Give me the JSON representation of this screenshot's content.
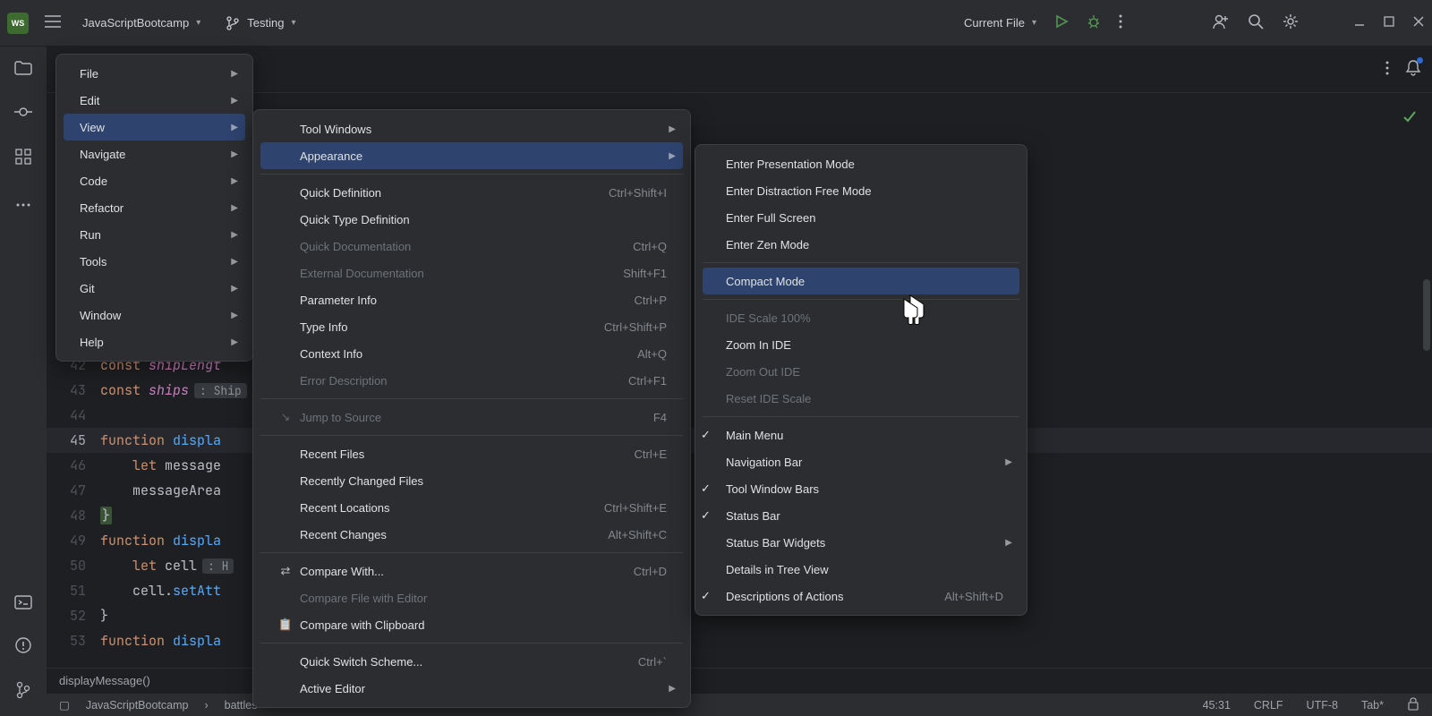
{
  "titlebar": {
    "project": "JavaScriptBootcamp",
    "branch": "Testing",
    "run_config": "Current File"
  },
  "code": {
    "lines": [
      {
        "n": "42",
        "html": "const shipLengt"
      },
      {
        "n": "43",
        "html": "const ships"
      },
      {
        "n": "44",
        "html": ""
      },
      {
        "n": "45",
        "html": "function displa"
      },
      {
        "n": "46",
        "html": "    let message"
      },
      {
        "n": "47",
        "html": "    messageArea"
      },
      {
        "n": "48",
        "html": "}"
      },
      {
        "n": "49",
        "html": "function displa"
      },
      {
        "n": "50",
        "html": "    let cell"
      },
      {
        "n": "51",
        "html": "    cell.setAtt"
      },
      {
        "n": "52",
        "html": "}"
      },
      {
        "n": "53",
        "html": "function displa"
      }
    ],
    "ann43": ": Ship",
    "ann50": ": H"
  },
  "menu1": {
    "items": [
      {
        "label": "File",
        "arrow": true
      },
      {
        "label": "Edit",
        "arrow": true
      },
      {
        "label": "View",
        "arrow": true,
        "selected": true
      },
      {
        "label": "Navigate",
        "arrow": true
      },
      {
        "label": "Code",
        "arrow": true
      },
      {
        "label": "Refactor",
        "arrow": true
      },
      {
        "label": "Run",
        "arrow": true
      },
      {
        "label": "Tools",
        "arrow": true
      },
      {
        "label": "Git",
        "arrow": true
      },
      {
        "label": "Window",
        "arrow": true
      },
      {
        "label": "Help",
        "arrow": true
      }
    ]
  },
  "menu2": {
    "groups": [
      [
        {
          "label": "Tool Windows",
          "arrow": true
        },
        {
          "label": "Appearance",
          "arrow": true,
          "selected": true
        }
      ],
      [
        {
          "label": "Quick Definition",
          "shortcut": "Ctrl+Shift+I"
        },
        {
          "label": "Quick Type Definition"
        },
        {
          "label": "Quick Documentation",
          "shortcut": "Ctrl+Q",
          "disabled": true
        },
        {
          "label": "External Documentation",
          "shortcut": "Shift+F1",
          "disabled": true
        },
        {
          "label": "Parameter Info",
          "shortcut": "Ctrl+P"
        },
        {
          "label": "Type Info",
          "shortcut": "Ctrl+Shift+P"
        },
        {
          "label": "Context Info",
          "shortcut": "Alt+Q"
        },
        {
          "label": "Error Description",
          "shortcut": "Ctrl+F1",
          "disabled": true
        }
      ],
      [
        {
          "label": "Jump to Source",
          "shortcut": "F4",
          "disabled": true,
          "icon": "↘"
        }
      ],
      [
        {
          "label": "Recent Files",
          "shortcut": "Ctrl+E"
        },
        {
          "label": "Recently Changed Files"
        },
        {
          "label": "Recent Locations",
          "shortcut": "Ctrl+Shift+E"
        },
        {
          "label": "Recent Changes",
          "shortcut": "Alt+Shift+C"
        }
      ],
      [
        {
          "label": "Compare With...",
          "shortcut": "Ctrl+D",
          "icon": "⇄"
        },
        {
          "label": "Compare File with Editor",
          "disabled": true
        },
        {
          "label": "Compare with Clipboard",
          "icon": "📋"
        }
      ],
      [
        {
          "label": "Quick Switch Scheme...",
          "shortcut": "Ctrl+`"
        },
        {
          "label": "Active Editor",
          "arrow": true
        }
      ]
    ]
  },
  "menu3": {
    "groups": [
      [
        {
          "label": "Enter Presentation Mode"
        },
        {
          "label": "Enter Distraction Free Mode"
        },
        {
          "label": "Enter Full Screen"
        },
        {
          "label": "Enter Zen Mode"
        }
      ],
      [
        {
          "label": "Compact Mode",
          "selected": true
        }
      ],
      [
        {
          "label": "IDE Scale 100%",
          "disabled": true
        },
        {
          "label": "Zoom In IDE"
        },
        {
          "label": "Zoom Out IDE",
          "disabled": true
        },
        {
          "label": "Reset IDE Scale",
          "disabled": true
        }
      ],
      [
        {
          "label": "Main Menu",
          "check": true
        },
        {
          "label": "Navigation Bar",
          "arrow": true
        },
        {
          "label": "Tool Window Bars",
          "check": true
        },
        {
          "label": "Status Bar",
          "check": true
        },
        {
          "label": "Status Bar Widgets",
          "arrow": true
        },
        {
          "label": "Details in Tree View"
        },
        {
          "label": "Descriptions of Actions",
          "shortcut": "Alt+Shift+D",
          "check": true
        }
      ]
    ]
  },
  "breadcrumb": {
    "p1": "JavaScriptBootcamp",
    "p2": "battles",
    "fn": "displayMessage()"
  },
  "status": {
    "pos": "45:31",
    "sep": "CRLF",
    "enc": "UTF-8",
    "indent": "Tab*"
  }
}
